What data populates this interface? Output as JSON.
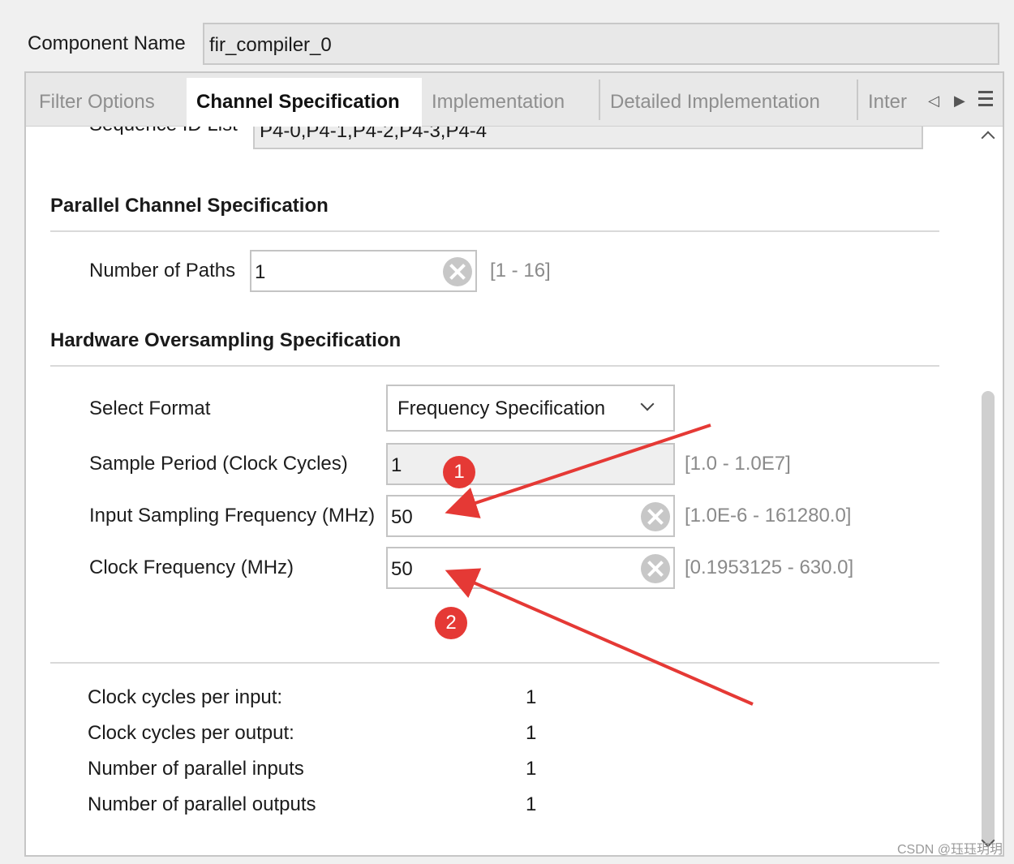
{
  "component": {
    "label": "Component Name",
    "value": "fir_compiler_0"
  },
  "tabs": [
    {
      "label": "Filter Options",
      "active": false
    },
    {
      "label": "Channel Specification",
      "active": true
    },
    {
      "label": "Implementation",
      "active": false
    },
    {
      "label": "Detailed Implementation",
      "active": false
    },
    {
      "label": "Inter",
      "active": false
    }
  ],
  "tab_controls": {
    "prev_icon": "triangle-left-icon",
    "next_icon": "triangle-right-icon",
    "menu_icon": "hamburger-menu-icon"
  },
  "sequence": {
    "label": "Sequence ID List",
    "value": "P4-0,P4-1,P4-2,P4-3,P4-4"
  },
  "parallel": {
    "title": "Parallel Channel Specification",
    "paths_label": "Number of Paths",
    "paths_value": "1",
    "paths_range": "[1 - 16]"
  },
  "oversampling": {
    "title": "Hardware Oversampling Specification",
    "format_label": "Select Format",
    "format_value": "Frequency Specification",
    "sample_period_label": "Sample Period (Clock Cycles)",
    "sample_period_value": "1",
    "sample_period_range": "[1.0 - 1.0E7]",
    "input_freq_label": "Input Sampling Frequency (MHz)",
    "input_freq_value": "50",
    "input_freq_range": "[1.0E-6 - 161280.0]",
    "clock_freq_label": "Clock Frequency (MHz)",
    "clock_freq_value": "50",
    "clock_freq_range": "[0.1953125 - 630.0]"
  },
  "summary": [
    {
      "label": "Clock cycles per input:",
      "value": "1"
    },
    {
      "label": "Clock cycles per output:",
      "value": "1"
    },
    {
      "label": "Number of parallel inputs",
      "value": "1"
    },
    {
      "label": "Number of parallel outputs",
      "value": "1"
    }
  ],
  "annotations": {
    "badge1": "1",
    "badge2": "2",
    "color": "#e53935"
  },
  "watermark": "CSDN @珏珏玥玥"
}
